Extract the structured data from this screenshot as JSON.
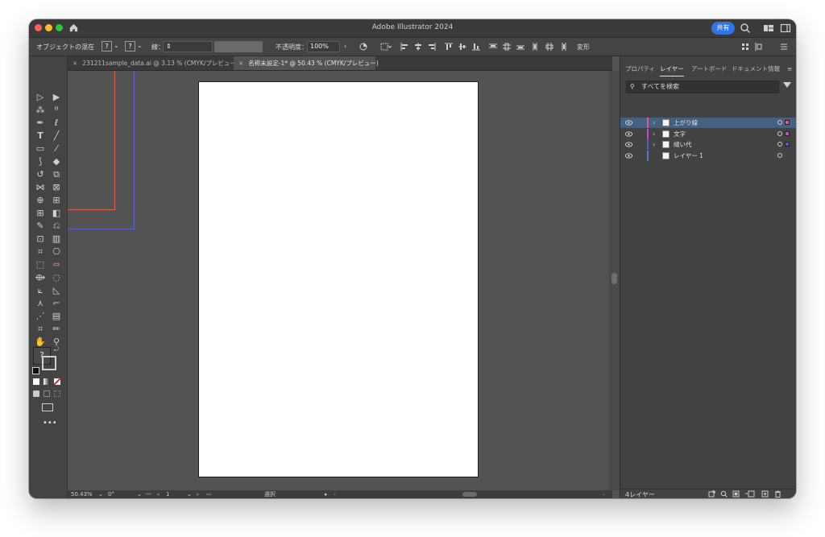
{
  "app": {
    "title": "Adobe Illustrator 2024",
    "share_label": "共有"
  },
  "control_bar": {
    "selection_label": "オブジェクトの混在",
    "fill_value": "?",
    "stroke_value": "?",
    "stroke_label": "線：",
    "opacity_label": "不透明度：",
    "opacity_value": "100%",
    "transform_label": "変形"
  },
  "document_tabs": [
    {
      "label": "231211sample_data.ai @ 3.13 % (CMYK/プレビュー)",
      "active": false
    },
    {
      "label": "名称未設定-1* @ 50.43 % (CMYK/プレビュー)",
      "active": true
    }
  ],
  "toolbar": {
    "fill_stroke_question": "?"
  },
  "status_bar": {
    "zoom": "50.43%",
    "rotation": "0°",
    "artboard_number": "1",
    "mode": "選択"
  },
  "panel": {
    "tabs": [
      "プロパティ",
      "レイヤー",
      "アートボード",
      "ドキュメント情報"
    ],
    "active_tab": "レイヤー",
    "search_placeholder": "すべてを検索",
    "layers": [
      {
        "name": "上がり線",
        "color": "#e05a8a",
        "selected": true,
        "expandable": true
      },
      {
        "name": "文字",
        "color": "#c24ad0",
        "selected": false,
        "expandable": true
      },
      {
        "name": "縫い代",
        "color": "#4b5bd6",
        "selected": false,
        "expandable": true
      },
      {
        "name": "レイヤー 1",
        "color": "#5578d6",
        "selected": false,
        "expandable": false
      }
    ],
    "layer_count": "4レイヤー"
  },
  "colors": {
    "accent": "#2f74e6",
    "canvas": "#535353",
    "panel": "#424242",
    "artboard_guide_red": "#d9604a",
    "artboard_guide_blue": "#5d5fd0"
  }
}
